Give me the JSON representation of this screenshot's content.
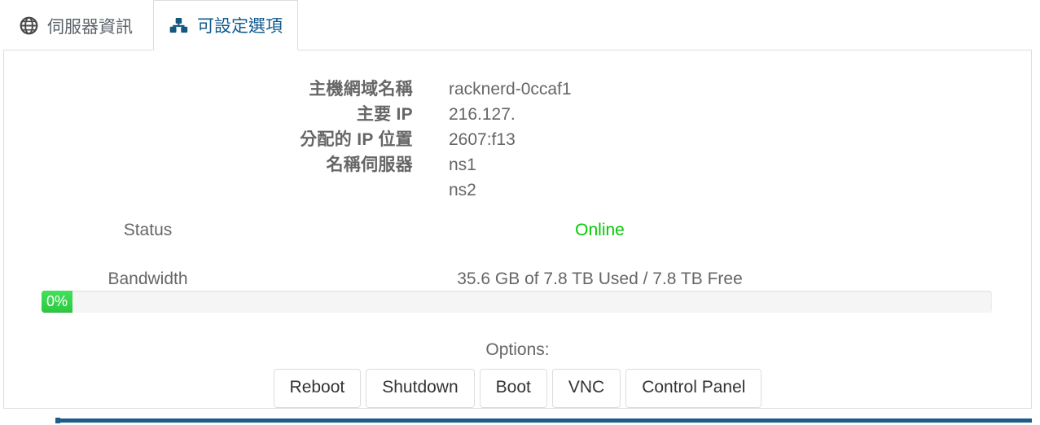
{
  "tabs": [
    {
      "id": "server-information",
      "label": "伺服器資訊",
      "icon": "globe-icon",
      "active": false
    },
    {
      "id": "configurable-options",
      "label": "可設定選項",
      "icon": "cubes-icon",
      "active": true
    }
  ],
  "details": [
    {
      "label": "主機網域名稱",
      "value": "racknerd-0ccaf1"
    },
    {
      "label": "主要 IP",
      "value": "216.127."
    },
    {
      "label": "分配的 IP 位置",
      "value": "2607:f13"
    }
  ],
  "nameservers": {
    "label": "名稱伺服器",
    "values": [
      "ns1",
      "ns2"
    ]
  },
  "status": {
    "label": "Status",
    "value": "Online",
    "color": "#00cc00"
  },
  "bandwidth": {
    "label": "Bandwidth",
    "value": "35.6 GB of 7.8 TB Used / 7.8 TB Free",
    "progress_label": "0%",
    "progress_percent": 0,
    "progress_color": "#32d74b"
  },
  "options": {
    "title": "Options:",
    "buttons": [
      {
        "id": "reboot",
        "label": "Reboot"
      },
      {
        "id": "shutdown",
        "label": "Shutdown"
      },
      {
        "id": "boot",
        "label": "Boot"
      },
      {
        "id": "vnc",
        "label": "VNC"
      },
      {
        "id": "control-panel",
        "label": "Control Panel"
      }
    ]
  },
  "theme": {
    "accent": "#1f5c8b",
    "tab_active_text": "#0f5a8f",
    "border": "#dddddd"
  }
}
